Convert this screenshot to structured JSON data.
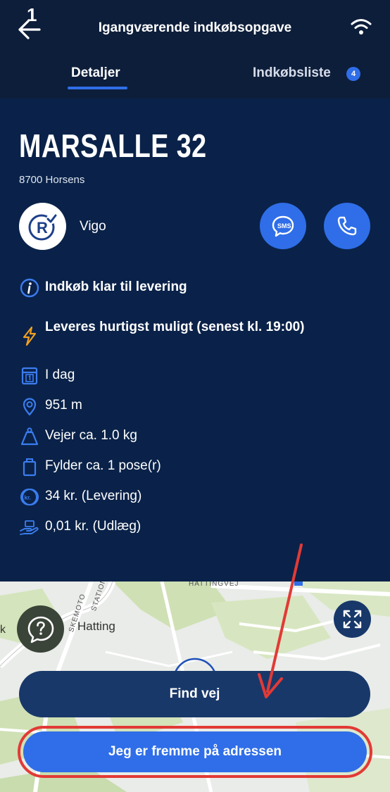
{
  "header": {
    "back_badge": "1",
    "title": "Igangværende indkøbsopgave",
    "tabs": [
      {
        "label": "Detaljer",
        "active": true
      },
      {
        "label": "Indkøbsliste",
        "badge": "4"
      }
    ]
  },
  "order": {
    "address": "MARSALLE 32",
    "city": "8700 Horsens",
    "customer_name": "Vigo",
    "sms_label": "SMS",
    "status": "Indkøb klar til levering",
    "delivery_time": "Leveres hurtigst muligt (senest kl. 19:00)",
    "day": "I dag",
    "distance": "951 m",
    "weight": "Vejer ca. 1.0 kg",
    "bags": "Fylder ca. 1 pose(r)",
    "delivery_price": "34 kr. (Levering)",
    "outlay": "0,01 kr. (Udlæg)",
    "price_icon_text": "kr."
  },
  "map": {
    "labels": [
      "Hatting",
      "HATTINGVEJ",
      "STATIONS",
      "SKEMOTO"
    ],
    "edge_letter": "k"
  },
  "actions": {
    "find_route": "Find vej",
    "arrived": "Jeg er fremme på adressen"
  },
  "colors": {
    "background": "#0a2249",
    "header": "#0d1e3a",
    "accent": "#2f6ee8",
    "dark_button": "#18386a",
    "warning_icon": "#f0a020",
    "annotation": "#e23a36"
  }
}
